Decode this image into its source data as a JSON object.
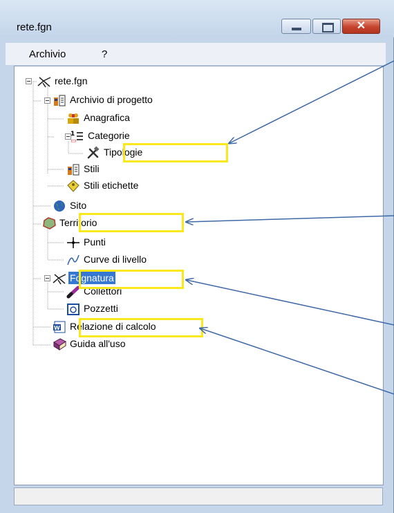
{
  "window": {
    "title": "rete.fgn",
    "close_glyph": "✕"
  },
  "menu": {
    "items": [
      "Archivio",
      "?"
    ]
  },
  "tree": {
    "root": "rete.fgn",
    "archivio_di_progetto": "Archivio di progetto",
    "anagrafica": "Anagrafica",
    "categorie": "Categorie",
    "tipologie": "Tipologie",
    "stili": "Stili",
    "stili_etichette": "Stili etichette",
    "sito": "Sito",
    "territorio": "Territorio",
    "punti": "Punti",
    "curve_di_livello": "Curve di livello",
    "fognatura": "Fognatura",
    "collettori": "Collettori",
    "pozzetti": "Pozzetti",
    "relazione_di_calcolo": "Relazione di calcolo",
    "guida_all_uso": "Guida all'uso"
  },
  "statusbar": {
    "text": ""
  },
  "colors": {
    "highlight": "#f8e81c",
    "callout": "#3e68a6",
    "selection": "#3478d1"
  }
}
